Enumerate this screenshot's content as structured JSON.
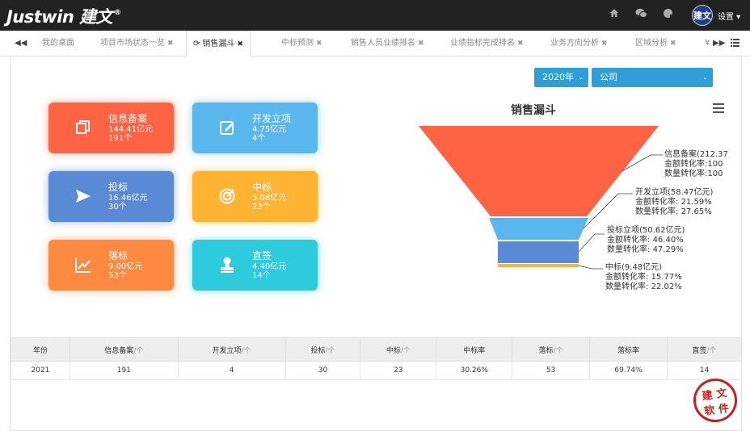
{
  "header": {
    "logo_text": "Justwin 建文",
    "avatar_text": "建文",
    "settings_label": "设置 ▾",
    "icons": [
      "home-icon",
      "wechat-icon",
      "skin-icon"
    ]
  },
  "tabs": [
    {
      "label": "我的桌面",
      "closable": false
    },
    {
      "label": "项目市场状态一览",
      "closable": true
    },
    {
      "label": "销售漏斗",
      "closable": true,
      "active": true
    },
    {
      "label": "中标预测",
      "closable": true
    },
    {
      "label": "销售人员业绩排名",
      "closable": true
    },
    {
      "label": "业绩指标完成排名",
      "closable": true
    },
    {
      "label": "业务方向分析",
      "closable": true
    },
    {
      "label": "区域分析",
      "closable": true
    },
    {
      "label": "¥",
      "closable": false
    }
  ],
  "filters": {
    "year": "2020年",
    "scope": "公司"
  },
  "cards": [
    {
      "name": "信息备案",
      "amount": "144.41亿元",
      "count": "191个",
      "color": "#fe6344",
      "icon": "copy-icon"
    },
    {
      "name": "开发立项",
      "amount": "4.75亿元",
      "count": "4个",
      "color": "#5ab7ed",
      "icon": "edit-icon"
    },
    {
      "name": "投标",
      "amount": "16.46亿元",
      "count": "30个",
      "color": "#5a89d6",
      "icon": "send-icon"
    },
    {
      "name": "中标",
      "amount": "5.08亿元",
      "count": "23个",
      "color": "#feb332",
      "icon": "target-icon"
    },
    {
      "name": "落标",
      "amount": "9.00亿元",
      "count": "53个",
      "color": "#fe8a42",
      "icon": "chart-line-icon"
    },
    {
      "name": "直签",
      "amount": "4.40亿元",
      "count": "14个",
      "color": "#2ecbde",
      "icon": "stamp-icon"
    }
  ],
  "chart_data": {
    "type": "funnel",
    "title": "销售漏斗",
    "stages": [
      {
        "name": "信息备案",
        "value_label": "(212.37",
        "amount_rate": "100",
        "count_rate": "100",
        "color": "#fe6344"
      },
      {
        "name": "开发立项",
        "value_label": "(58.47亿元)",
        "amount_rate": "21.59%",
        "count_rate": "27.65%",
        "color": "#5ab7ed"
      },
      {
        "name": "投标立项",
        "value_label": "(50.62亿元)",
        "amount_rate": "46.40%",
        "count_rate": "47.29%",
        "color": "#5a89d6"
      },
      {
        "name": "中标",
        "value_label": "(9.48亿元)",
        "amount_rate": "15.77%",
        "count_rate": "22.02%",
        "color": "#feb332"
      }
    ],
    "amount_rate_label": "金额转化率:",
    "count_rate_label": "数量转化率:"
  },
  "table": {
    "headers": [
      {
        "label": "年份",
        "unit": ""
      },
      {
        "label": "信息备案",
        "unit": "/个"
      },
      {
        "label": "开发立项",
        "unit": "/个"
      },
      {
        "label": "投标",
        "unit": "/个"
      },
      {
        "label": "中标",
        "unit": "/个"
      },
      {
        "label": "中标率",
        "unit": ""
      },
      {
        "label": "落标",
        "unit": "/个"
      },
      {
        "label": "落标率",
        "unit": ""
      },
      {
        "label": "直签",
        "unit": "/个"
      }
    ],
    "rows": [
      [
        "2021",
        "191",
        "4",
        "30",
        "23",
        "30.26%",
        "53",
        "69.74%",
        "14"
      ]
    ]
  },
  "seal_chars": [
    "建",
    "文",
    "软",
    "件"
  ]
}
